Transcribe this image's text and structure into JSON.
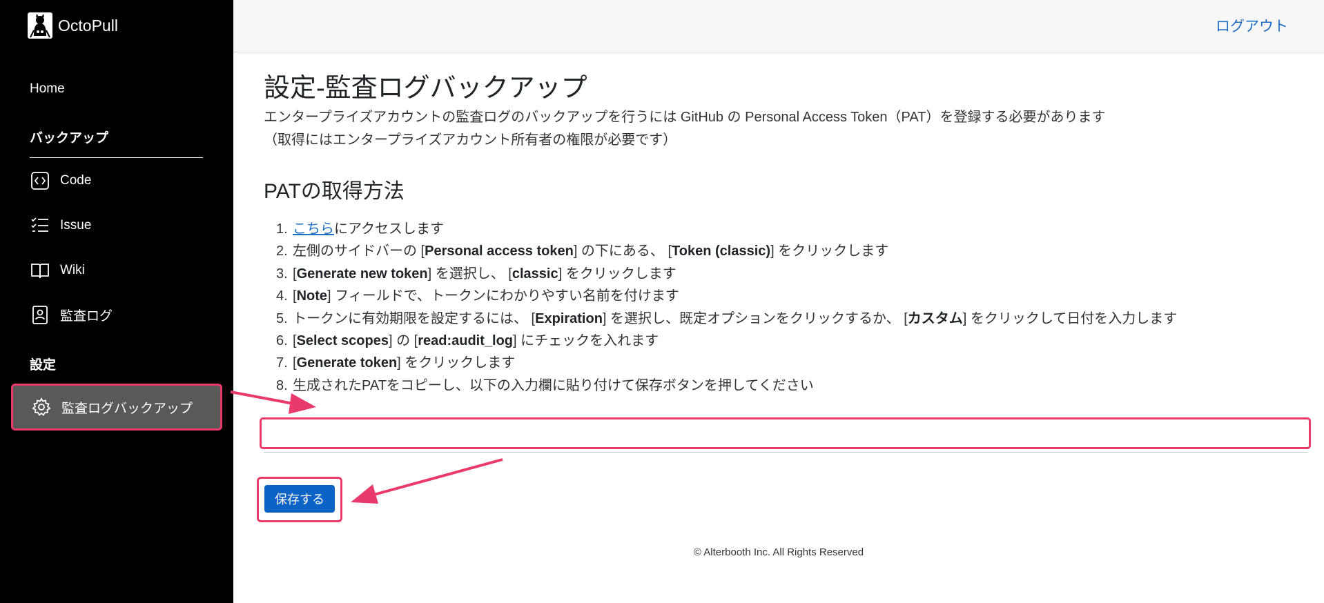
{
  "app": {
    "name": "OctoPull",
    "logo_icon": "octocat-logo-icon"
  },
  "header": {
    "logout_label": "ログアウト"
  },
  "sidebar": {
    "home_label": "Home",
    "backup_section": "バックアップ",
    "items": [
      {
        "label": "Code",
        "icon": "code-icon"
      },
      {
        "label": "Issue",
        "icon": "checklist-icon"
      },
      {
        "label": "Wiki",
        "icon": "book-icon"
      },
      {
        "label": "監査ログ",
        "icon": "id-card-icon"
      }
    ],
    "settings_section": "設定",
    "active_item": {
      "label": "監査ログバックアップ",
      "icon": "gear-icon"
    }
  },
  "main": {
    "title": "設定-監査ログバックアップ",
    "intro_line1": "エンタープライズアカウントの監査ログのバックアップを行うには GitHub の Personal Access Token（PAT）を登録する必要があります",
    "intro_line2": "（取得にはエンタープライズアカウント所有者の権限が必要です）",
    "subtitle": "PATの取得方法",
    "steps": {
      "s1": {
        "num": "1.",
        "link": "こちら",
        "rest": "にアクセスします"
      },
      "s2": {
        "num": "2.",
        "t1": "左側のサイドバーの [",
        "b1": "Personal access token",
        "t2": "] の下にある、 [",
        "b2": "Token (classic)",
        "t3": "] をクリックします"
      },
      "s3": {
        "num": "3.",
        "t1": "[",
        "b1": "Generate new token",
        "t2": "] を選択し、 [",
        "b2": "classic",
        "t3": "] をクリックします"
      },
      "s4": {
        "num": "4.",
        "t1": "[",
        "b1": "Note",
        "t2": "] フィールドで、トークンにわかりやすい名前を付けます"
      },
      "s5": {
        "num": "5.",
        "t1": "トークンに有効期限を設定するには、 [",
        "b1": "Expiration",
        "t2": "] を選択し、既定オプションをクリックするか、 [",
        "b2": "カスタム",
        "t3": "] をクリックして日付を入力します"
      },
      "s6": {
        "num": "6.",
        "t1": "[",
        "b1": "Select scopes",
        "t2": "] の [",
        "b2": "read:audit_log",
        "t3": "] にチェックを入れます"
      },
      "s7": {
        "num": "7.",
        "t1": "[",
        "b1": "Generate token",
        "t2": "] をクリックします"
      },
      "s8": {
        "num": "8.",
        "t1": "生成されたPATをコピーし、以下の入力欄に貼り付けて保存ボタンを押してください"
      }
    },
    "pat_input_value": "",
    "save_label": "保存する"
  },
  "footer": {
    "copyright": "© Alterbooth Inc. All Rights Reserved"
  },
  "colors": {
    "sidebar_bg": "#000000",
    "active_item_bg": "#595959",
    "highlight": "#ea3a6c",
    "primary_button": "#0b63c6",
    "link": "#1e6fc4"
  }
}
